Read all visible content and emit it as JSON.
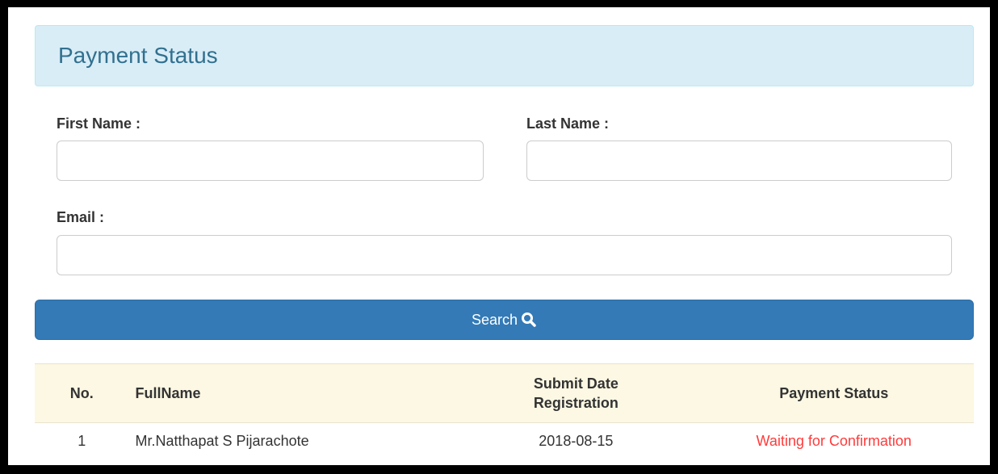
{
  "panel": {
    "title": "Payment Status"
  },
  "form": {
    "first_name_label": "First Name :",
    "first_name_value": "",
    "last_name_label": "Last Name :",
    "last_name_value": "",
    "email_label": "Email :",
    "email_value": "",
    "search_label": "Search",
    "search_icon": "search-icon"
  },
  "table": {
    "headers": {
      "no": "No.",
      "fullname": "FullName",
      "submit_date_line1": "Submit Date",
      "submit_date_line2": "Registration",
      "payment_status": "Payment Status"
    },
    "rows": [
      {
        "no": "1",
        "fullname": "Mr.Natthapat S Pijarachote",
        "submit_date": "2018-08-15",
        "payment_status": "Waiting for Confirmation"
      }
    ]
  },
  "colors": {
    "heading_bg": "#d9edf7",
    "heading_text": "#31708f",
    "button_bg": "#337ab7",
    "table_header_bg": "#fcf8e3",
    "status_waiting": "#ff3b3b"
  }
}
